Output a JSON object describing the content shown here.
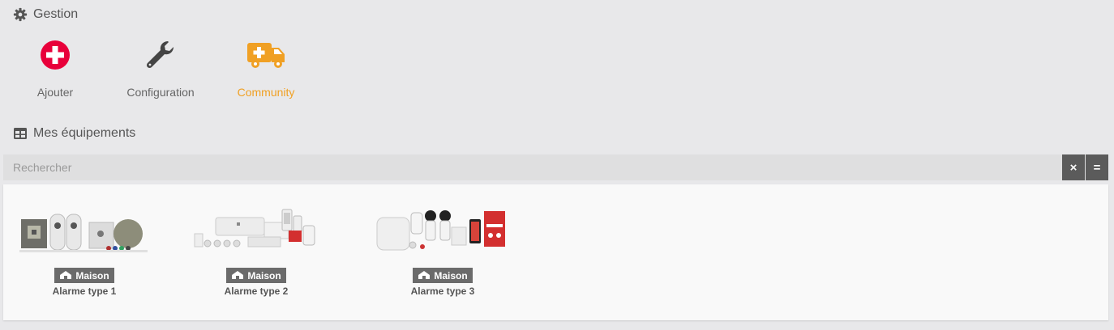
{
  "gestion": {
    "title": "Gestion",
    "actions": [
      {
        "label": "Ajouter",
        "icon": "plus-circle-icon",
        "color": "#e8003a"
      },
      {
        "label": "Configuration",
        "icon": "wrench-icon",
        "color": "#444444"
      },
      {
        "label": "Community",
        "icon": "ambulance-icon",
        "color": "#f0a024"
      }
    ]
  },
  "equipements": {
    "title": "Mes équipements",
    "search": {
      "placeholder": "Rechercher",
      "value": ""
    },
    "clear_label": "×",
    "collapse_label": "="
  },
  "devices": [
    {
      "badge": "Maison",
      "name": "Alarme type 1"
    },
    {
      "badge": "Maison",
      "name": "Alarme type 2"
    },
    {
      "badge": "Maison",
      "name": "Alarme type 3"
    }
  ]
}
